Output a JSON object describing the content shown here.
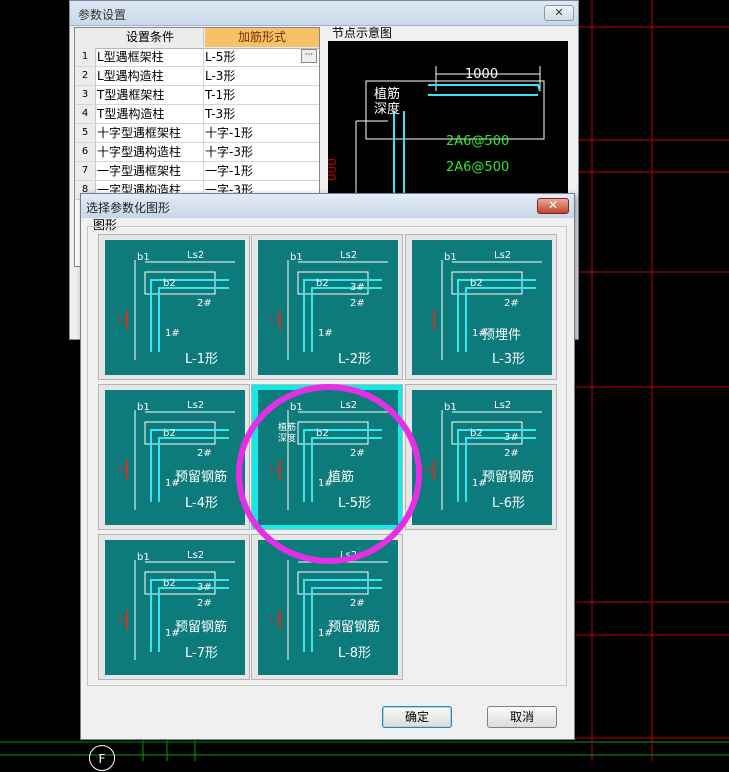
{
  "param_dialog": {
    "title": "参数设置",
    "close": "✕",
    "col_condition": "设置条件",
    "col_form": "加筋形式",
    "ellipsis": "···",
    "rows": [
      {
        "num": "1",
        "condition": "L型遇框架柱",
        "form": "L-5形"
      },
      {
        "num": "2",
        "condition": "L型遇构造柱",
        "form": "L-3形"
      },
      {
        "num": "3",
        "condition": "T型遇框架柱",
        "form": "T-1形"
      },
      {
        "num": "4",
        "condition": "T型遇构造柱",
        "form": "T-3形"
      },
      {
        "num": "5",
        "condition": "十字型遇框架柱",
        "form": "十字-1形"
      },
      {
        "num": "6",
        "condition": "十字型遇构造柱",
        "form": "十字-3形"
      },
      {
        "num": "7",
        "condition": "一字型遇框架柱",
        "form": "一字-1形"
      },
      {
        "num": "8",
        "condition": "一字型遇构造柱",
        "form": "一字-3形"
      }
    ],
    "node_diagram_label": "节点示意图",
    "node_diagram": {
      "dim": "1000",
      "planting_1": "植筋",
      "planting_2": "深度",
      "rebar_1": "2A6@500",
      "rebar_2": "2A6@500",
      "side_dim": "000"
    }
  },
  "shape_dialog": {
    "title": "选择参数化图形",
    "close": "✕",
    "group_label": "图形",
    "selected": "L-5",
    "tiles": [
      {
        "id": "L-1",
        "label": "L-1形",
        "b1": "b1",
        "b2": "b2",
        "ls2": "Ls2",
        "ls": "Ls",
        "r1": "1#",
        "r2": "2#"
      },
      {
        "id": "L-2",
        "label": "L-2形",
        "b1": "b1",
        "b2": "b2",
        "ls2": "Ls2",
        "ls": "Ls",
        "r1": "1#",
        "r2": "2#",
        "r3": "3#",
        "b": "b"
      },
      {
        "id": "L-3",
        "label": "L-3形",
        "sub": "预埋件",
        "b1": "b1",
        "b2": "b2",
        "ls2": "Ls2",
        "r1": "1#",
        "r2": "2#"
      },
      {
        "id": "L-4",
        "label": "L-4形",
        "sub": "预留钢筋",
        "b1": "b1",
        "b2": "b2",
        "ls2": "Ls2",
        "ls": "Ls",
        "r1": "1#",
        "r2": "2#"
      },
      {
        "id": "L-5",
        "label": "L-5形",
        "sub": "植筋",
        "b1": "b1",
        "b2": "b2",
        "ls2": "Ls2",
        "ls": "Ls",
        "r1": "1#",
        "r2": "2#",
        "planting_1": "植筋",
        "planting_2": "深度"
      },
      {
        "id": "L-6",
        "label": "L-6形",
        "sub": "预留钢筋",
        "b1": "b1",
        "b2": "b2",
        "ls2": "Ls2",
        "ls": "Ls",
        "r1": "1#",
        "r2": "2#",
        "r3": "3#"
      },
      {
        "id": "L-7",
        "label": "L-7形",
        "sub": "预留钢筋",
        "b1": "b1",
        "b2": "b2",
        "ls2": "Ls2",
        "ls": "Ls",
        "r1": "1#",
        "r2": "2#",
        "r3": "3#"
      },
      {
        "id": "L-8",
        "label": "L-8形",
        "sub": "预留钢筋",
        "ls2": "Ls2",
        "ls": "Ls",
        "r1": "1#",
        "r2": "2#"
      }
    ],
    "ok": "确定",
    "cancel": "取消"
  },
  "cad": {
    "axis_label": "F"
  },
  "colors": {
    "tile_bg": "#0d7b7b",
    "selected_border": "#12eaea",
    "highlight": "#e62ee6",
    "rebar_cyan": "#35e6f0",
    "dim_white": "#ffffff",
    "mark_red": "#c0392b",
    "grid_red": "#b00000",
    "grid_green": "#00a000"
  }
}
